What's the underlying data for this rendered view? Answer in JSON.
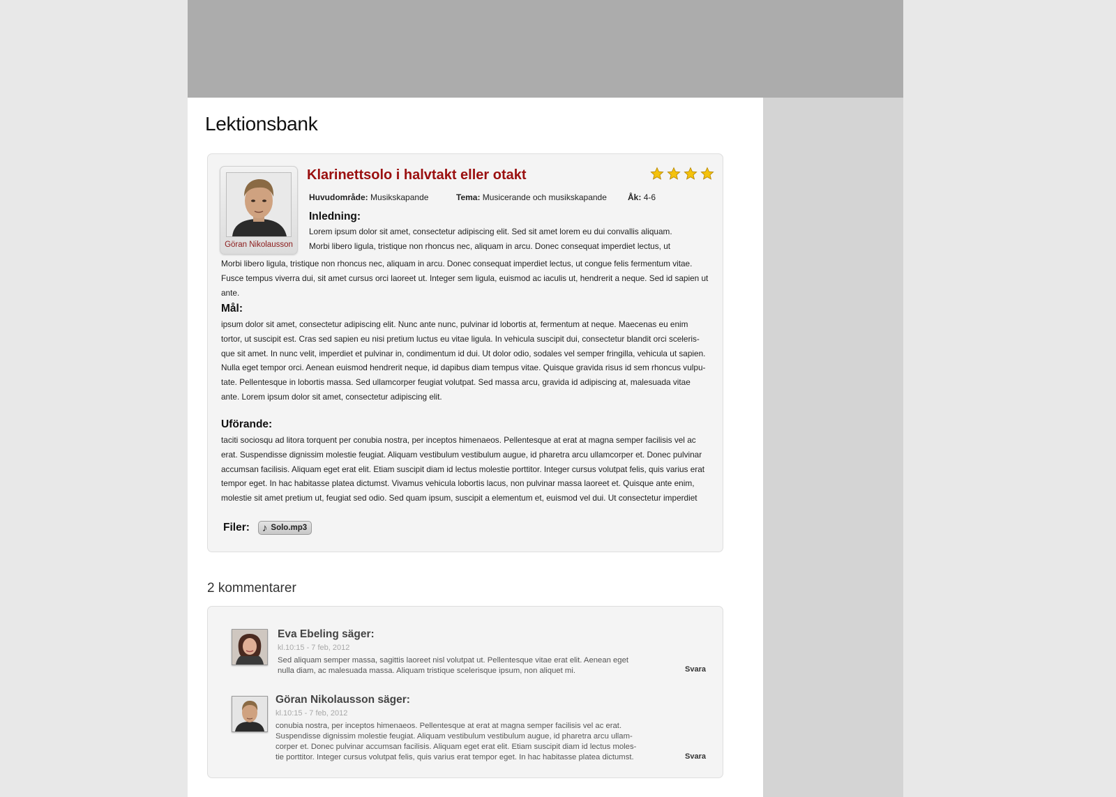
{
  "page": {
    "title": "Lektionsbank"
  },
  "lesson": {
    "title": "Klarinettsolo i halvtakt eller otakt",
    "rating": 4,
    "author": {
      "name": "Göran Nikolausson",
      "icon": "author-photo"
    },
    "meta": [
      {
        "label": "Huvudområde:",
        "value": "Musikskapande"
      },
      {
        "label": "Tema:",
        "value": "Musicerande och musikskapande"
      },
      {
        "label": "Åk:",
        "value": "4-6"
      }
    ],
    "sections": [
      {
        "heading": "Inledning:",
        "lines": [
          "Lorem ipsum dolor sit amet, consectetur adipiscing elit. Sed sit amet lorem eu dui convallis aliquam.",
          "Morbi libero ligula, tristique non rhoncus nec, aliquam in arcu. Donec consequat imperdiet lectus, ut",
          "Morbi libero ligula, tristique non rhoncus nec, aliquam in arcu. Donec consequat imperdiet lectus, ut congue felis fermentum vitae.",
          "Fusce tempus viverra dui, sit amet cursus orci laoreet ut. Integer sem ligula, euismod ac iaculis ut, hendrerit a neque. Sed id sapien ut",
          "ante."
        ]
      },
      {
        "heading": "Mål:",
        "lines": [
          "ipsum dolor sit amet, consectetur adipiscing elit. Nunc ante nunc, pulvinar id lobortis at, fermentum at neque. Maecenas eu enim",
          "tortor, ut suscipit est. Cras sed sapien eu nisi pretium luctus eu vitae ligula. In vehicula suscipit dui, consectetur blandit orci sceleris-",
          "que sit amet. In nunc velit, imperdiet et pulvinar in, condimentum id dui. Ut dolor odio, sodales vel semper fringilla, vehicula ut sapien.",
          "Nulla eget tempor orci. Aenean euismod hendrerit neque, id dapibus diam tempus vitae. Quisque gravida risus id sem rhoncus vulpu-",
          "tate. Pellentesque in lobortis massa. Sed ullamcorper feugiat volutpat. Sed massa arcu, gravida id adipiscing at, malesuada vitae",
          "ante. Lorem ipsum dolor sit amet, consectetur adipiscing elit."
        ]
      },
      {
        "heading": "Uförande:",
        "lines": [
          "taciti sociosqu ad litora torquent per conubia nostra, per inceptos himenaeos. Pellentesque at erat at magna semper facilisis vel ac",
          "erat. Suspendisse dignissim molestie feugiat. Aliquam vestibulum vestibulum augue, id pharetra arcu ullamcorper et. Donec pulvinar",
          "accumsan facilisis. Aliquam eget erat elit. Etiam suscipit diam id lectus molestie porttitor. Integer cursus volutpat felis, quis varius erat",
          "tempor eget. In hac habitasse platea dictumst. Vivamus vehicula lobortis lacus, non pulvinar massa laoreet et. Quisque ante enim,",
          "molestie sit amet pretium ut, feugiat sed odio. Sed quam ipsum, suscipit a elementum et, euismod vel dui. Ut consectetur imperdiet"
        ]
      }
    ],
    "files": {
      "label": "Filer:",
      "items": [
        {
          "name": "Solo.mp3",
          "icon": "music-note-icon"
        }
      ]
    }
  },
  "comments": {
    "title": "2 kommentarer",
    "items": [
      {
        "author": "Eva Ebeling säger:",
        "date": "kl.10:15 - 7 feb, 2012",
        "lines": [
          "Sed aliquam semper massa, sagittis laoreet nisl volutpat ut. Pellentesque vitae erat elit. Aenean eget",
          "nulla diam, ac malesuada massa. Aliquam tristique scelerisque ipsum, non aliquet mi."
        ],
        "reply": "Svara"
      },
      {
        "author": "Göran Nikolausson säger:",
        "date": "kl.10:15 - 7 feb, 2012",
        "lines": [
          "conubia nostra, per inceptos himenaeos. Pellentesque at erat at magna semper facilisis vel ac erat.",
          "Suspendisse dignissim molestie feugiat. Aliquam vestibulum vestibulum augue, id pharetra arcu ullam-",
          "corper et. Donec pulvinar accumsan facilisis. Aliquam eget erat elit. Etiam suscipit diam id lectus moles-",
          "tie porttitor. Integer cursus volutpat felis, quis varius erat tempor eget. In hac habitasse platea dictumst."
        ],
        "reply": "Svara"
      }
    ]
  },
  "colors": {
    "header": "#acacac",
    "sidebar": "#d4d4d4",
    "background": "#e8e8e8",
    "title_red": "#9a0f0f",
    "star": "#f4c20d"
  }
}
